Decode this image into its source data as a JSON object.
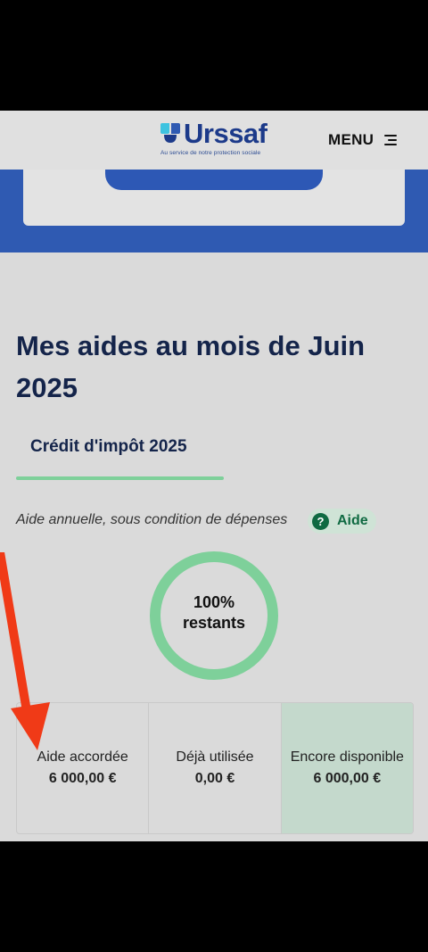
{
  "header": {
    "logo_word": "Urssaf",
    "logo_tagline": "Au service de notre protection sociale",
    "menu_label": "MENU"
  },
  "page": {
    "title": "Mes aides au mois de Juin 2025",
    "active_tab": "Crédit d'impôt 2025",
    "subtitle": "Aide annuelle, sous condition de dépenses",
    "help_label": "Aide",
    "help_icon_glyph": "?",
    "progress": {
      "percent_remaining": 100,
      "line1": "100%",
      "line2": "restants"
    }
  },
  "stats": [
    {
      "label": "Aide accordée",
      "value": "6 000,00 €"
    },
    {
      "label": "Déjà utilisée",
      "value": "0,00 €"
    },
    {
      "label": "Encore disponible",
      "value": "6 000,00 €"
    }
  ],
  "colors": {
    "brand_blue": "#2f5ab2",
    "title_navy": "#14244a",
    "accent_green": "#7ed09a",
    "help_green": "#0f6a42",
    "annotation_red": "#f03a17"
  }
}
